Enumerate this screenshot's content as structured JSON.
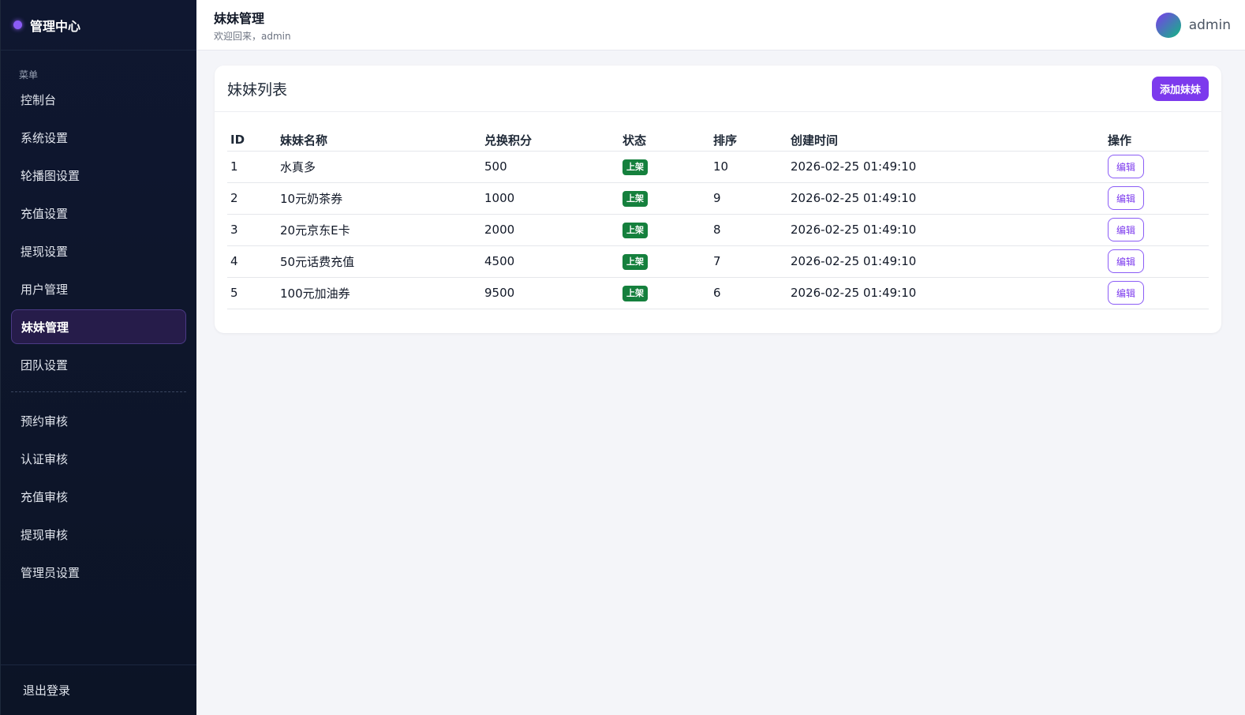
{
  "sidebar": {
    "brand": "管理中心",
    "menu_label": "菜单",
    "items": [
      {
        "label": "控制台"
      },
      {
        "label": "系统设置"
      },
      {
        "label": "轮播图设置"
      },
      {
        "label": "充值设置"
      },
      {
        "label": "提现设置"
      },
      {
        "label": "用户管理"
      },
      {
        "label": "妹妹管理",
        "active": true
      },
      {
        "label": "团队设置"
      }
    ],
    "review_items": [
      {
        "label": "预约审核"
      },
      {
        "label": "认证审核"
      },
      {
        "label": "充值审核"
      },
      {
        "label": "提现审核"
      },
      {
        "label": "管理员设置"
      }
    ],
    "logout": "退出登录"
  },
  "header": {
    "title": "妹妹管理",
    "subtitle": "欢迎回来，admin",
    "username": "admin"
  },
  "card": {
    "title": "妹妹列表",
    "add_label": "添加妹妹"
  },
  "table": {
    "columns": [
      "ID",
      "妹妹名称",
      "兑换积分",
      "状态",
      "排序",
      "创建时间",
      "操作"
    ],
    "rows": [
      {
        "id": "1",
        "name": "水真多",
        "points": "500",
        "status": "上架",
        "sort": "10",
        "created": "2026-02-25 01:49:10",
        "action": "编辑"
      },
      {
        "id": "2",
        "name": "10元奶茶券",
        "points": "1000",
        "status": "上架",
        "sort": "9",
        "created": "2026-02-25 01:49:10",
        "action": "编辑"
      },
      {
        "id": "3",
        "name": "20元京东E卡",
        "points": "2000",
        "status": "上架",
        "sort": "8",
        "created": "2026-02-25 01:49:10",
        "action": "编辑"
      },
      {
        "id": "4",
        "name": "50元话费充值",
        "points": "4500",
        "status": "上架",
        "sort": "7",
        "created": "2026-02-25 01:49:10",
        "action": "编辑"
      },
      {
        "id": "5",
        "name": "100元加油券",
        "points": "9500",
        "status": "上架",
        "sort": "6",
        "created": "2026-02-25 01:49:10",
        "action": "编辑"
      }
    ]
  },
  "colors": {
    "accent": "#7c3aed",
    "sidebar_bg": "#0f1730",
    "status_on": "#15803d"
  }
}
